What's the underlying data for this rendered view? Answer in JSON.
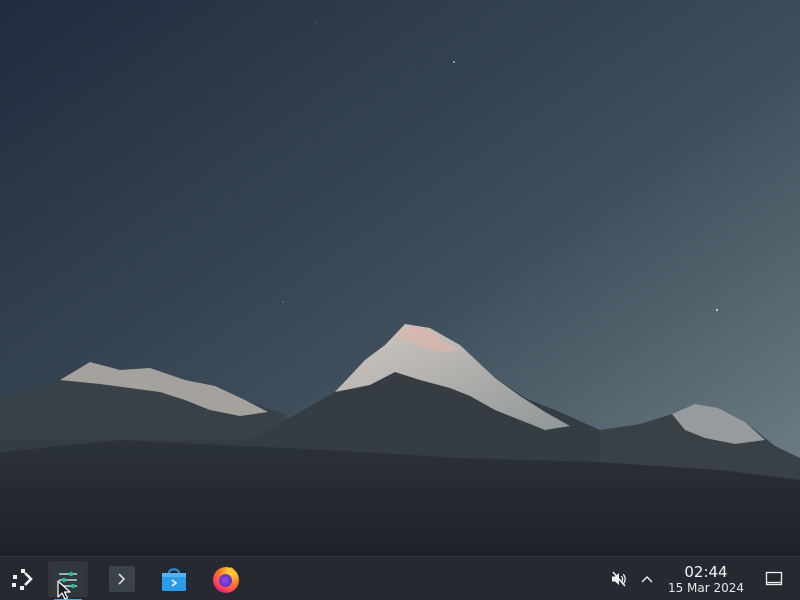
{
  "desktop": {
    "wallpaper": "mountain-range-at-dusk"
  },
  "taskbar": {
    "launcher": {
      "icon": "application-launcher-icon"
    },
    "items": [
      {
        "icon": "system-settings-icon",
        "active": true
      },
      {
        "icon": "terminal-icon",
        "active": false
      },
      {
        "icon": "discover-store-icon",
        "active": false
      },
      {
        "icon": "firefox-icon",
        "active": false
      }
    ]
  },
  "tray": {
    "volume": {
      "icon": "volume-muted-icon",
      "muted": true
    },
    "expand": {
      "icon": "chevron-up-icon"
    },
    "clock": {
      "time": "02:44",
      "date": "15 Mar 2024"
    },
    "show_desktop": {
      "icon": "show-desktop-icon"
    }
  },
  "colors": {
    "taskbar_bg": "#262a30",
    "accent": "#3daee9",
    "text": "#eff0f1"
  }
}
